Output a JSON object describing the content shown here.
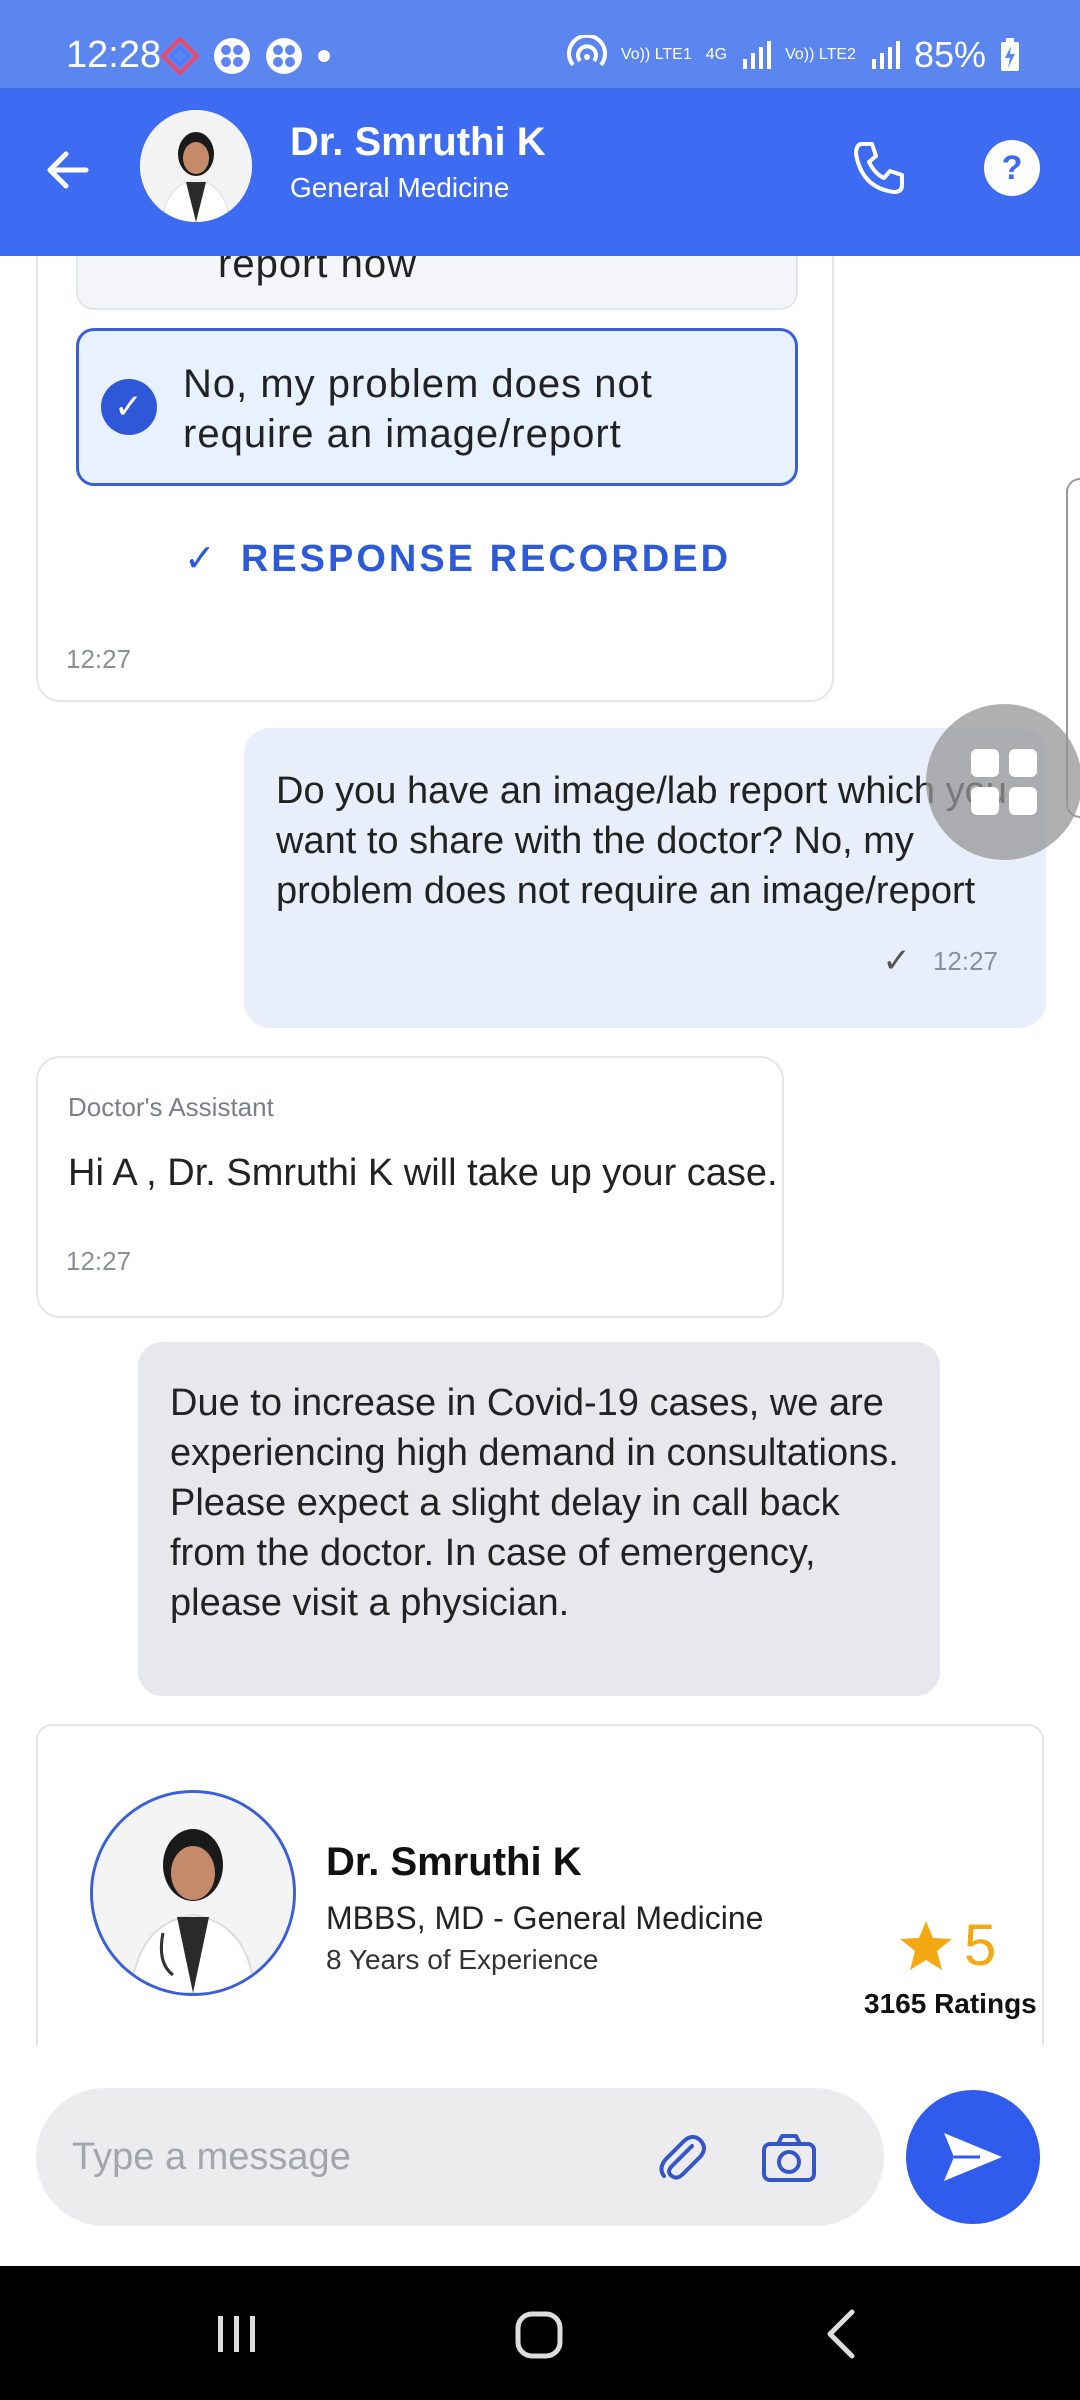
{
  "status_bar": {
    "time": "12:28",
    "battery": "85%",
    "network_1": "Vo)) LTE1",
    "network_2": "Vo)) LTE2",
    "network_type": "4G"
  },
  "header": {
    "doctor_name": "Dr. Smruthi K",
    "specialty": "General Medicine",
    "help_label": "?"
  },
  "options_card": {
    "previous_option": "report now",
    "selected_option": "No, my problem does not require an image/report",
    "response_recorded": "RESPONSE RECORDED",
    "time": "12:27"
  },
  "user_message": {
    "text": "Do you have an image/lab report which you want to share with the doctor? No, my problem does not require an image/report",
    "time": "12:27"
  },
  "assistant_message": {
    "label": "Doctor's Assistant",
    "text": "Hi A , Dr. Smruthi K will take up your case.",
    "time": "12:27"
  },
  "notice": {
    "text": "Due to increase in Covid-19 cases, we are experiencing high demand in consultations. Please expect a slight delay in call back from the doctor. In case of emergency, please visit a physician."
  },
  "doctor_card": {
    "name": "Dr. Smruthi K",
    "qualification": "MBBS, MD - General Medicine",
    "experience": "8 Years of Experience",
    "rating": "5",
    "ratings_count": "3165 Ratings"
  },
  "composer": {
    "placeholder": "Type a message"
  },
  "colors": {
    "header": "#3d6cf2",
    "status_bar": "#5b86f0",
    "accent": "#2f5cec",
    "star": "#f4a812"
  }
}
